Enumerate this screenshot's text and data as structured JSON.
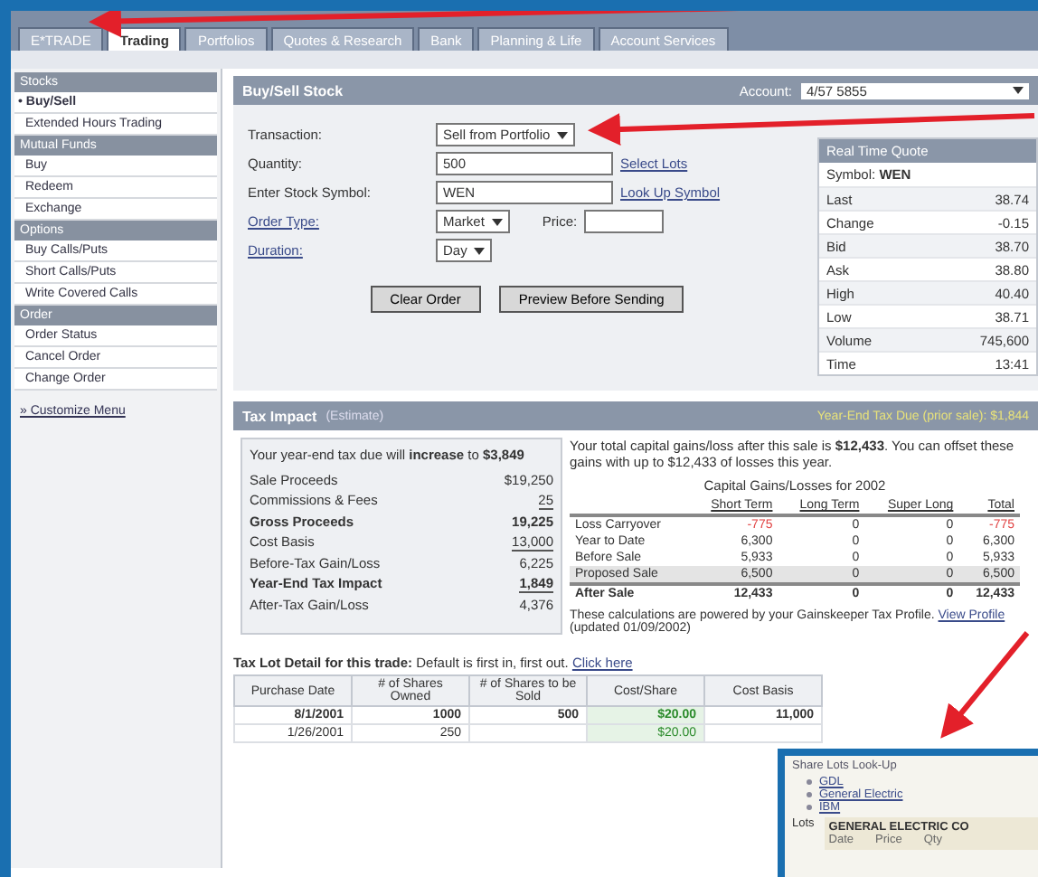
{
  "tabs": [
    {
      "label": "E*TRADE",
      "selected": false
    },
    {
      "label": "Trading",
      "selected": true
    },
    {
      "label": "Portfolios",
      "selected": false
    },
    {
      "label": "Quotes & Research",
      "selected": false
    },
    {
      "label": "Bank",
      "selected": false
    },
    {
      "label": "Planning & Life",
      "selected": false
    },
    {
      "label": "Account Services",
      "selected": false
    }
  ],
  "sidebar": {
    "sections": [
      {
        "title": "Stocks",
        "items": [
          {
            "label": "• Buy/Sell",
            "selected": true
          },
          {
            "label": "Extended Hours Trading",
            "selected": false
          }
        ]
      },
      {
        "title": "Mutual Funds",
        "items": [
          {
            "label": "Buy",
            "selected": false
          },
          {
            "label": "Redeem",
            "selected": false
          },
          {
            "label": "Exchange",
            "selected": false
          }
        ]
      },
      {
        "title": "Options",
        "items": [
          {
            "label": "Buy Calls/Puts",
            "selected": false
          },
          {
            "label": "Short Calls/Puts",
            "selected": false
          },
          {
            "label": "Write Covered Calls",
            "selected": false
          }
        ]
      },
      {
        "title": "Order",
        "items": [
          {
            "label": "Order Status",
            "selected": false
          },
          {
            "label": "Cancel Order",
            "selected": false
          },
          {
            "label": "Change Order",
            "selected": false
          }
        ]
      }
    ],
    "footer_link": "» Customize Menu"
  },
  "order_form": {
    "title": "Buy/Sell Stock",
    "account_label": "Account:",
    "account": "4/57 5855",
    "fields": [
      {
        "kind": "select",
        "label": "Transaction:",
        "value": "Sell from Portfolio"
      },
      {
        "kind": "input",
        "label": "Quantity:",
        "value": "500",
        "link": "Select Lots"
      },
      {
        "kind": "input",
        "label": "Enter Stock Symbol:",
        "value": "WEN",
        "link": "Look Up Symbol"
      },
      {
        "kind": "select",
        "label": "Order Type:",
        "value": "Market",
        "extra_label": "Price:"
      },
      {
        "kind": "select",
        "label": "Duration:",
        "value": "Day"
      }
    ],
    "buttons": [
      "Clear Order",
      "Preview Before Sending"
    ]
  },
  "quote": {
    "title": "Real Time Quote",
    "symbol_label": "Symbol:",
    "symbol": "WEN",
    "rows": [
      {
        "label": "Last",
        "value": "38.74"
      },
      {
        "label": "Change",
        "value": "-0.15"
      },
      {
        "label": "Bid",
        "value": "38.70"
      },
      {
        "label": "Ask",
        "value": "38.80"
      },
      {
        "label": "High",
        "value": "40.40"
      },
      {
        "label": "Low",
        "value": "38.71"
      },
      {
        "label": "Volume",
        "value": "745,600"
      },
      {
        "label": "Time",
        "value": "13:41"
      }
    ]
  },
  "tax_impact": {
    "title": "Tax Impact",
    "subtitle": "(Estimate)",
    "due": "Year-End Tax Due (prior sale): $1,844",
    "summary": "Your year-end tax due will **increase** to **$3,849**",
    "lines": [
      {
        "label": "Sale Proceeds",
        "value": "$19,250",
        "bold": false,
        "rule": false
      },
      {
        "label": "Commissions & Fees",
        "value": "25",
        "bold": false,
        "rule": true
      },
      {
        "label": "Gross Proceeds",
        "value": "19,225",
        "bold": true,
        "rule": false
      },
      {
        "label": "Cost Basis",
        "value": "13,000",
        "bold": false,
        "rule": true
      },
      {
        "label": "Before-Tax Gain/Loss",
        "value": "6,225",
        "bold": false,
        "rule": false
      },
      {
        "label": "Year-End Tax Impact",
        "value": "1,849",
        "bold": true,
        "rule": true
      },
      {
        "label": "After-Tax Gain/Loss",
        "value": "4,376",
        "bold": false,
        "rule": false
      }
    ],
    "gains_note": "Your total capital gains/loss after this sale is **$12,433**. You can offset these gains with up to $12,433 of losses this year.",
    "gains_title": "Capital Gains/Losses for 2002",
    "gains_columns": [
      "",
      "Short Term",
      "Long Term",
      "Super Long",
      "Total"
    ],
    "gains_rows": [
      {
        "cells": [
          "Loss Carryover",
          "-775",
          "0",
          "0",
          "-775"
        ],
        "negative": true,
        "selected": false,
        "bold": false
      },
      {
        "cells": [
          "Year to Date",
          "6,300",
          "0",
          "0",
          "6,300"
        ],
        "negative": false,
        "selected": false,
        "bold": false
      },
      {
        "cells": [
          "Before Sale",
          "5,933",
          "0",
          "0",
          "5,933"
        ],
        "negative": false,
        "selected": false,
        "bold": false
      },
      {
        "cells": [
          "Proposed Sale",
          "6,500",
          "0",
          "0",
          "6,500"
        ],
        "negative": false,
        "selected": true,
        "bold": false
      },
      {
        "cells": [
          "After Sale",
          "12,433",
          "0",
          "0",
          "12,433"
        ],
        "negative": false,
        "selected": false,
        "bold": true
      }
    ],
    "footnote": "These calculations are powered by your Gainskeeper Tax Profile.",
    "footnote_link": "View Profile",
    "footnote_date": "(updated 01/09/2002)"
  },
  "lot_detail": {
    "title": "Tax Lot Detail for this trade:",
    "note": "Default is first in, first out.",
    "link": "Click here",
    "columns": [
      "Purchase Date",
      "# of Shares Owned",
      "# of Shares to be Sold",
      "Cost/Share",
      "Cost Basis"
    ],
    "rows": [
      {
        "cells": [
          "8/1/2001",
          "1000",
          "500",
          "$20.00",
          "11,000"
        ],
        "selected": true
      },
      {
        "cells": [
          "1/26/2001",
          "250",
          "",
          "$20.00",
          ""
        ],
        "selected": false
      }
    ]
  },
  "inset": {
    "title": "Share Lots Look-Up",
    "links": [
      "GDL",
      "General Electric",
      "IBM"
    ],
    "label": "Lots",
    "company": "GENERAL ELECTRIC CO",
    "columns": [
      "Date",
      "Price",
      "Qty"
    ]
  }
}
